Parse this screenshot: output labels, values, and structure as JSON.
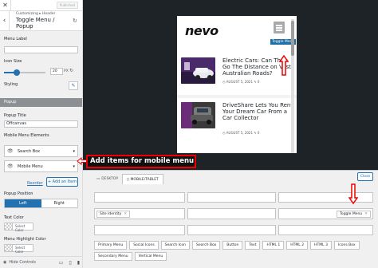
{
  "sidebar": {
    "published_label": "Published",
    "breadcrumb": "Customizing ▸ Header",
    "section_title": "Toggle Menu / Popup",
    "menu_label_label": "Menu Label",
    "menu_label_value": "",
    "icon_size_label": "Icon Size",
    "icon_size_value": "20",
    "icon_size_unit": "PX",
    "icon_size_fraction": 0.3,
    "styling_label": "Styling",
    "popup_bar": "Popup",
    "popup_title_label": "Popup Title",
    "popup_title_value": "Offcanvas",
    "mobile_elements_label": "Mobile Menu Elements",
    "elements": [
      "Search Box",
      "Mobile Menu"
    ],
    "reorder_label": "Reorder",
    "add_item_label": "+ Add an Item",
    "popup_position_label": "Popup Position",
    "positions": [
      {
        "label": "Left",
        "active": true
      },
      {
        "label": "Right",
        "active": false
      }
    ],
    "text_color_label": "Text Color",
    "select_color_label": "Select Color",
    "highlight_color_label": "Menu Highlight Color",
    "hide_controls_label": "Hide Controls"
  },
  "preview": {
    "logo": "nevo",
    "toggle_tip": "Toggle Menu",
    "posts": [
      {
        "title": "Electric Cars: Can They Go The Distance on Vast Australian Roads?",
        "date": "AUGUST 5, 2021",
        "comments": "0"
      },
      {
        "title": "DriveShare Lets You Rent Your Dream Car From a Car Collector",
        "date": "AUGUST 5, 2021",
        "comments": "0"
      }
    ]
  },
  "annotation": "Add items for mobile menu",
  "builder": {
    "tabs": [
      {
        "label": "DESKTOP",
        "icon": "desktop-icon",
        "active": false
      },
      {
        "label": "MOBILE/TABLET",
        "icon": "mobile-icon",
        "active": true
      }
    ],
    "close_label": "Close",
    "row2_chips": [
      "Site Identity"
    ],
    "row2_right_chip": "Toggle Menu",
    "available": [
      "Primary Menu",
      "Social Icons",
      "Search Icon",
      "Search Box",
      "Button",
      "Text",
      "HTML 1",
      "HTML 2",
      "HTML 3",
      "Icons Box",
      "Secondary Menu",
      "Vertical Menu"
    ]
  },
  "colors": {
    "accent": "#2271b1",
    "annotation": "#e00000",
    "sidebar_bg": "#f0f0f1",
    "canvas_bg": "#1d2327"
  }
}
